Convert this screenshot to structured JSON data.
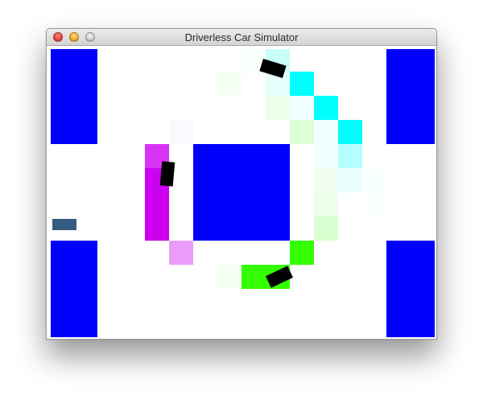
{
  "window": {
    "title": "Driverless Car Simulator"
  },
  "colors": {
    "building": "#0000ff",
    "car": "#000000",
    "parked_car": "#335b7f",
    "path_cyan_strong": "#00ffff",
    "path_magenta_strong": "#cc00ff",
    "path_green_strong": "#33ff00"
  },
  "icons": [
    "close-button",
    "minimize-button",
    "zoom-button"
  ]
}
